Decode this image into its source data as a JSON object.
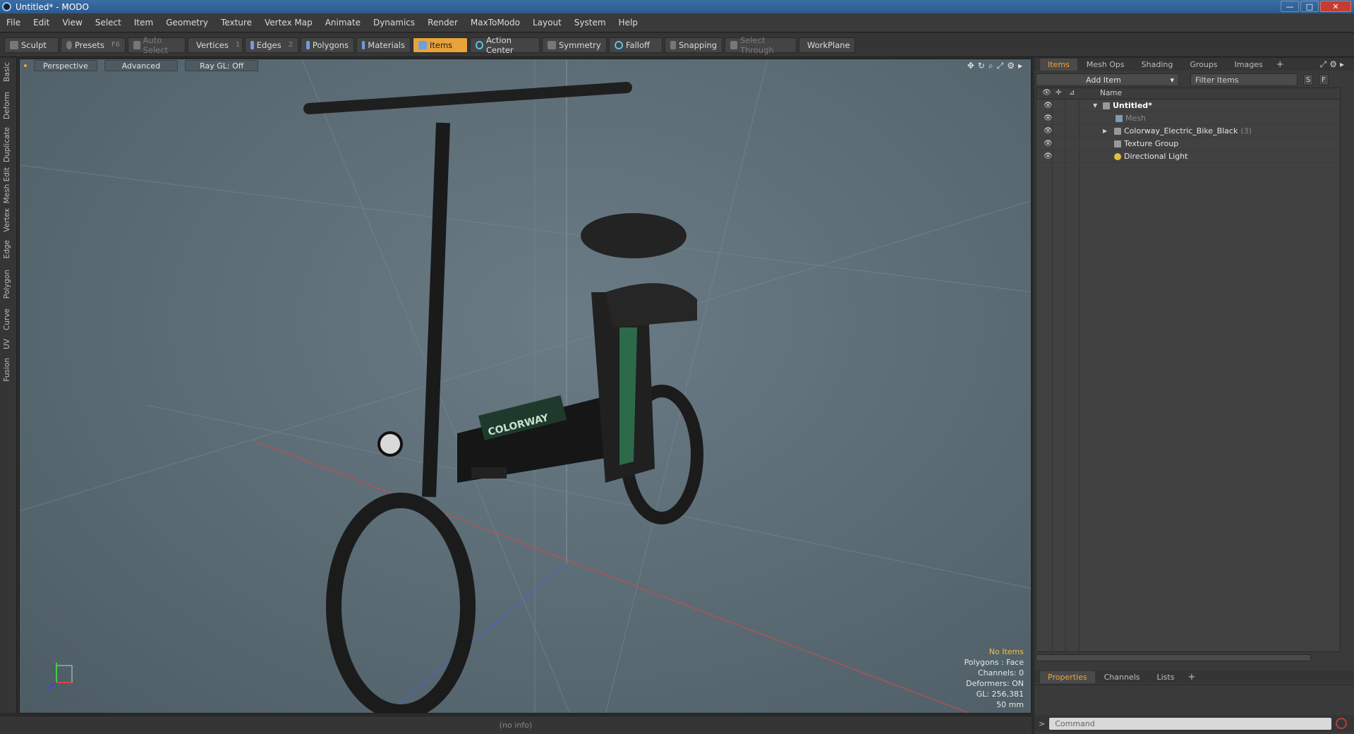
{
  "window": {
    "title": "Untitled* - MODO",
    "minimize": "—",
    "maximize": "□",
    "close": "✕"
  },
  "menu": [
    "File",
    "Edit",
    "View",
    "Select",
    "Item",
    "Geometry",
    "Texture",
    "Vertex Map",
    "Animate",
    "Dynamics",
    "Render",
    "MaxToModo",
    "Layout",
    "System",
    "Help"
  ],
  "toolbar": {
    "sculpt": "Sculpt",
    "presets": "Presets",
    "presets_key": "F6",
    "auto_select": "Auto Select",
    "vertices": "Vertices",
    "vertices_key": "1",
    "edges": "Edges",
    "edges_key": "2",
    "polygons": "Polygons",
    "materials": "Materials",
    "items": "Items",
    "action_center": "Action Center",
    "symmetry": "Symmetry",
    "falloff": "Falloff",
    "snapping": "Snapping",
    "select_through": "Select Through",
    "workplane": "WorkPlane"
  },
  "left_tabs": [
    "Basic",
    "Deform",
    "Duplicate",
    "Mesh Edit",
    "Vertex",
    "Edge",
    "Polygon",
    "Curve",
    "UV",
    "Fusion"
  ],
  "viewport": {
    "view": "Perspective",
    "shading": "Advanced",
    "raygl": "Ray GL: Off",
    "readout": {
      "selection": "No Items",
      "polygons": "Polygons : Face",
      "channels": "Channels: 0",
      "deformers": "Deformers: ON",
      "gl": "GL: 256,381",
      "size": "50 mm"
    },
    "bike_logo": "COLORWAY"
  },
  "status": "(no info)",
  "right_panel": {
    "tabs": [
      "Items",
      "Mesh Ops",
      "Shading",
      "Groups",
      "Images"
    ],
    "add_item": "Add Item",
    "filter_placeholder": "Filter Items",
    "s_btn": "S",
    "f_btn": "F",
    "name_header": "Name",
    "items": [
      {
        "label": "Untitled*",
        "count": ""
      },
      {
        "label": "Mesh",
        "count": ""
      },
      {
        "label": "Colorway_Electric_Bike_Black",
        "count": "(3)"
      },
      {
        "label": "Texture Group",
        "count": ""
      },
      {
        "label": "Directional Light",
        "count": ""
      }
    ],
    "bottom_tabs": [
      "Properties",
      "Channels",
      "Lists"
    ],
    "command_placeholder": "Command",
    "prompt": ">"
  }
}
